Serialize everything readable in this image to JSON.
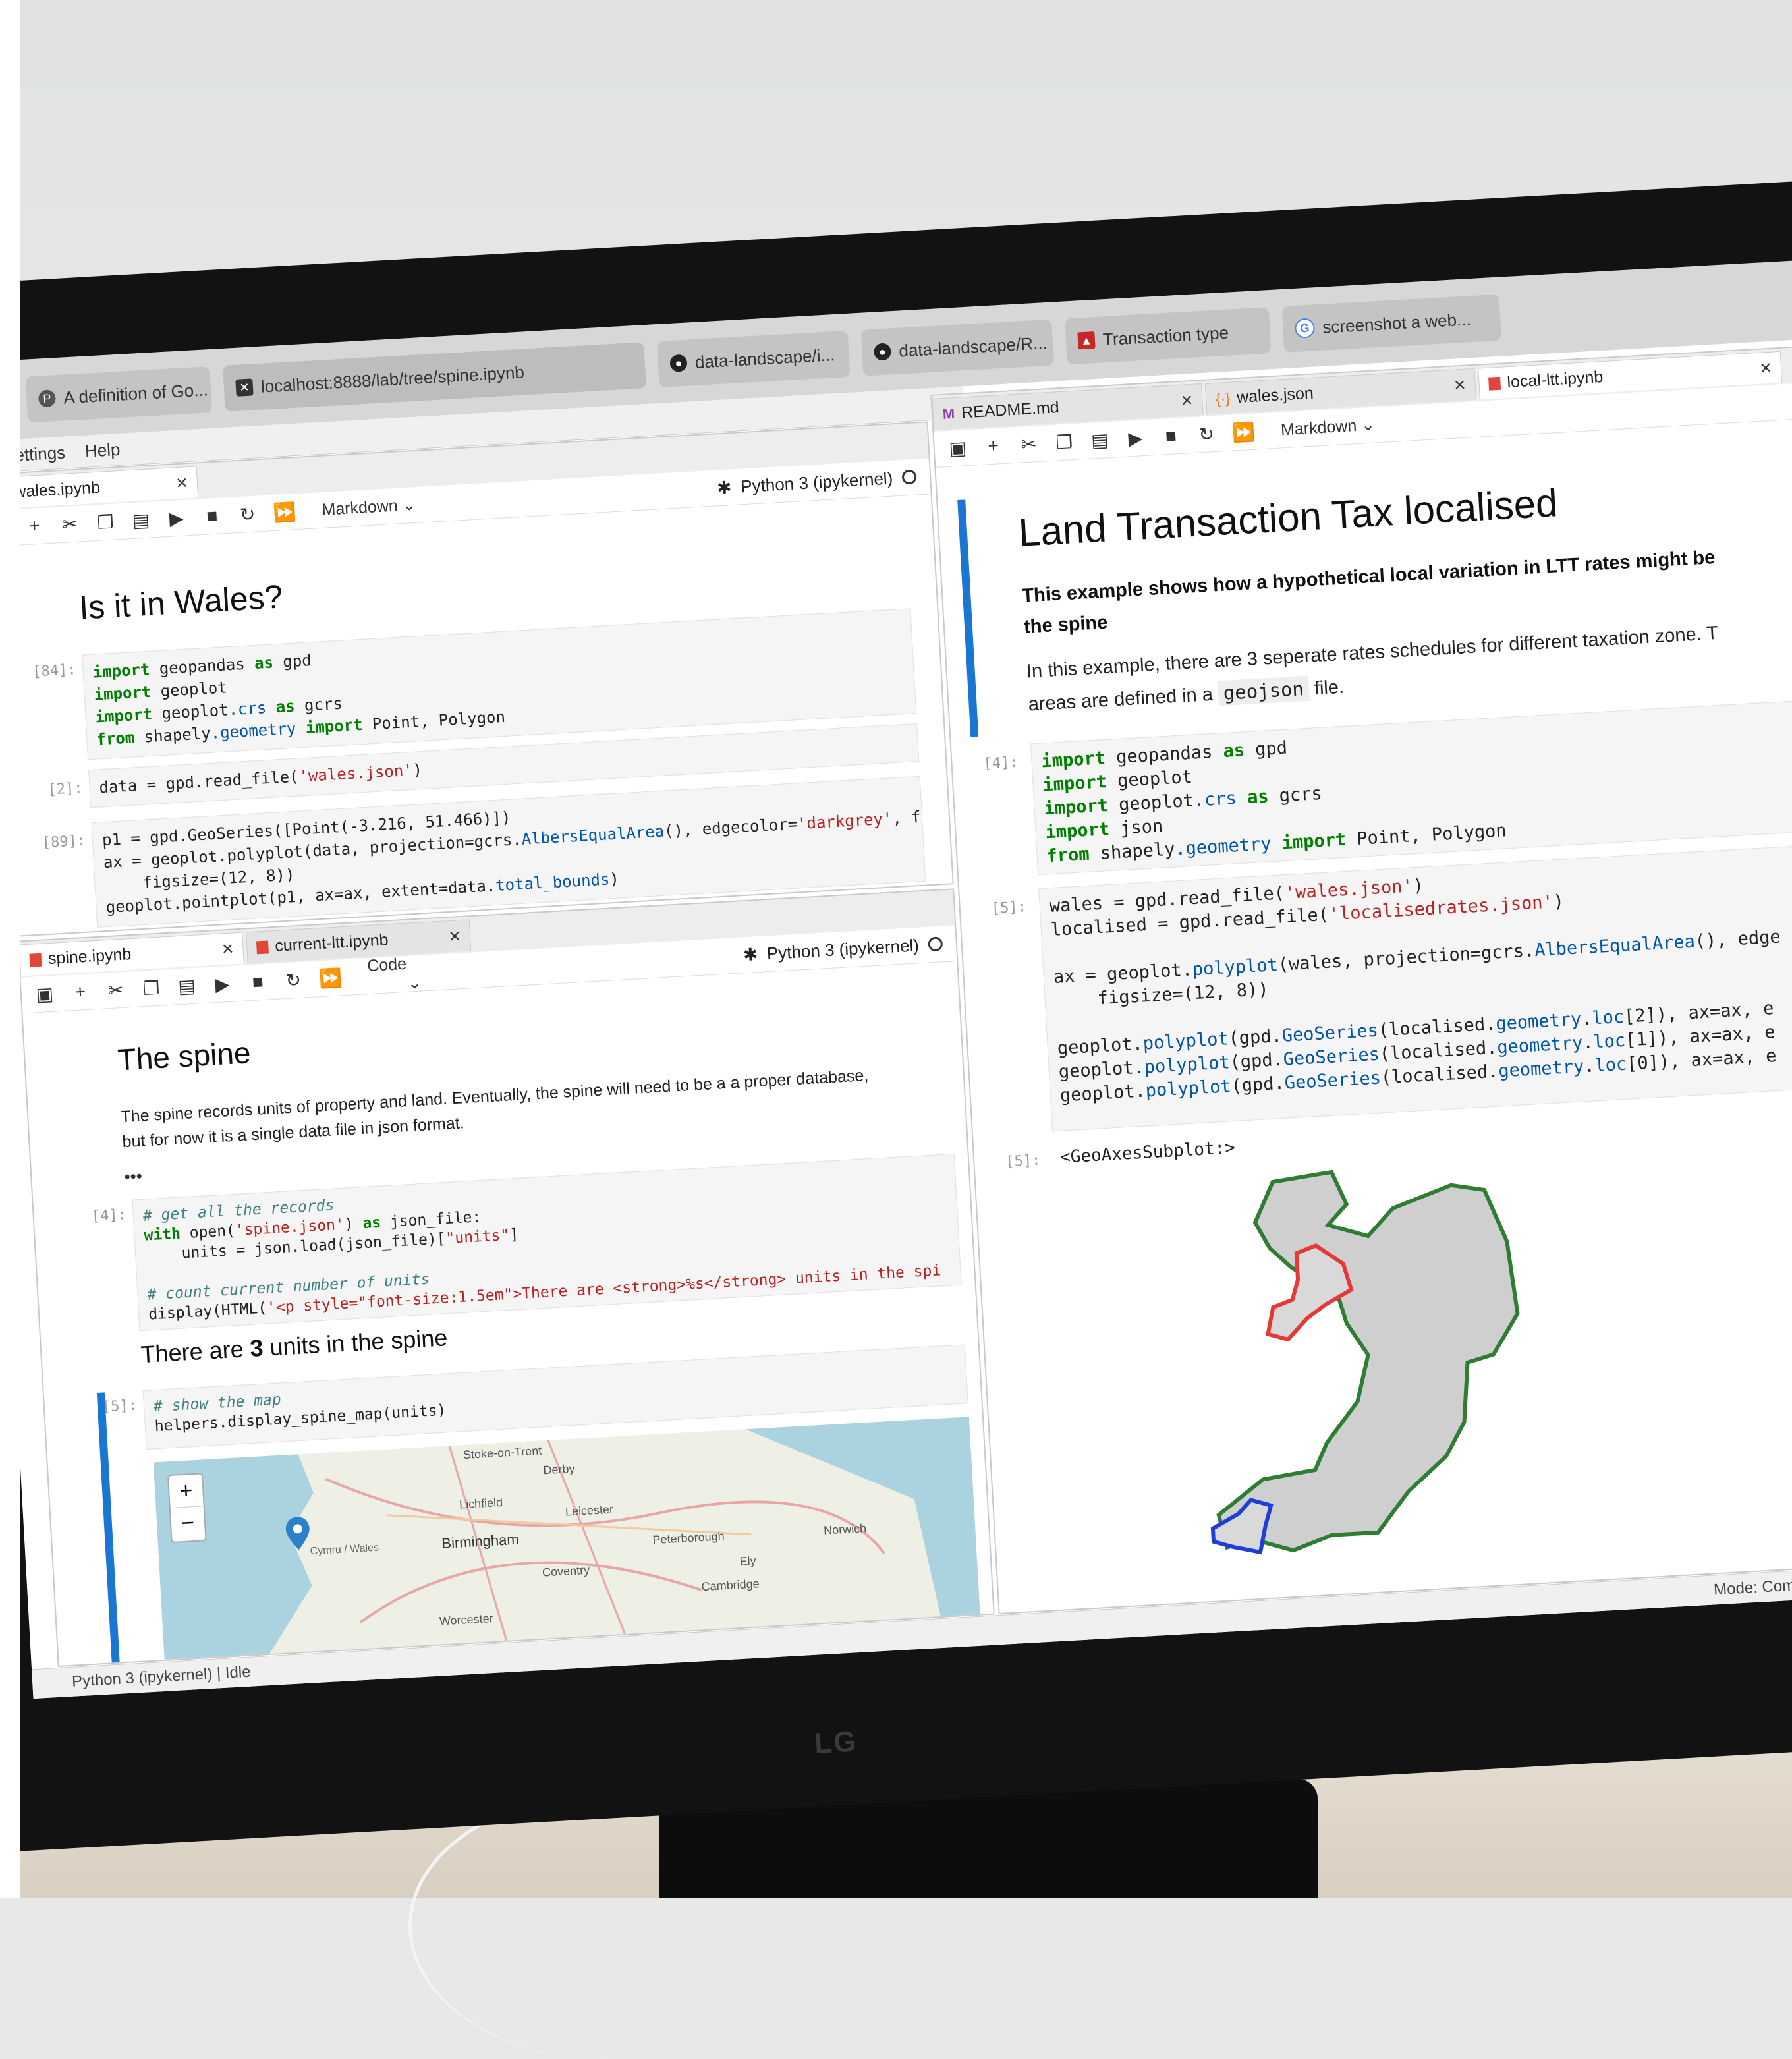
{
  "browser": {
    "tabs": [
      {
        "label": "A definition of Go...",
        "icon": "P"
      },
      {
        "label": "localhost:8888/lab/tree/spine.ipynb",
        "icon": "J"
      },
      {
        "label": "data-landscape/i...",
        "icon": "github"
      },
      {
        "label": "data-landscape/R...",
        "icon": "github"
      },
      {
        "label": "Transaction type",
        "icon": "wales-flag"
      },
      {
        "label": "screenshot a web...",
        "icon": "G"
      }
    ]
  },
  "menu": {
    "items": [
      "Settings",
      "Help"
    ]
  },
  "panel_top_left": {
    "tab": "iswales.ipynb",
    "cell_type": "Markdown",
    "kernel": "Python 3 (ipykernel)",
    "heading": "Is it in Wales?",
    "cells": [
      {
        "prompt": "[84]:",
        "lines": [
          "import geopandas as gpd",
          "import geoplot",
          "import geoplot.crs as gcrs",
          "from shapely.geometry import Point, Polygon"
        ]
      },
      {
        "prompt": "[2]:",
        "lines": [
          "data = gpd.read_file('wales.json')"
        ]
      },
      {
        "prompt": "[89]:",
        "lines": [
          "p1 = gpd.GeoSeries([Point(-3.216, 51.466)])",
          "ax = geoplot.polyplot(data, projection=gcrs.AlbersEqualArea(), edgecolor='darkgrey', fac",
          "    figsize=(12, 8))",
          "geoplot.pointplot(p1, ax=ax, extent=data.total_bounds)"
        ]
      }
    ]
  },
  "panel_bottom_left": {
    "tabs": [
      "spine.ipynb",
      "current-ltt.ipynb"
    ],
    "cell_type": "Code",
    "kernel": "Python 3 (ipykernel)",
    "heading": "The spine",
    "para1": "The spine records units of property and land. Eventually, the spine will need to be a a proper database,",
    "para2": "but for now it is a single data file in json format.",
    "ellipsis": "•••",
    "cell4": {
      "prompt": "[4]:",
      "lines": [
        "# get all the records",
        "with open('spine.json') as json_file:",
        "    units = json.load(json_file)[\"units\"]",
        "",
        "# count current number of units",
        "display(HTML('<p style=\"font-size:1.5em\">There are <strong>%s</strong> units in the spi"
      ]
    },
    "output_pre": "There are ",
    "output_num": "3",
    "output_post": " units in the spine",
    "cell5": {
      "prompt": "[5]:",
      "lines": [
        "# show the map",
        "helpers.display_spine_map(units)"
      ]
    },
    "map": {
      "zoom_in": "+",
      "zoom_out": "−",
      "places": [
        "Stoke-on-Trent",
        "Derby",
        "Lichfield",
        "Leicester",
        "Birmingham",
        "Peterborough",
        "Norwich",
        "Coventry",
        "Ely",
        "Cambridge",
        "Worcester",
        "Cymru / Wales"
      ]
    }
  },
  "panel_right": {
    "tabs": [
      "README.md",
      "wales.json",
      "local-ltt.ipynb"
    ],
    "cell_type": "Markdown",
    "heading": "Land Transaction Tax localised",
    "bold_line1": "This example shows how a hypothetical local variation in LTT rates might be",
    "bold_line2": "the spine",
    "para_line1": "In this example, there are 3 seperate rates schedules for different taxation zone. T",
    "para_line2_pre": "areas are defined in a ",
    "para_code": "geojson",
    "para_line2_post": " file.",
    "cell4": {
      "prompt": "[4]:",
      "lines": [
        "import geopandas as gpd",
        "import geoplot",
        "import geoplot.crs as gcrs",
        "import json",
        "from shapely.geometry import Point, Polygon"
      ]
    },
    "cell5": {
      "prompt": "[5]:",
      "lines": [
        "wales = gpd.read_file('wales.json')",
        "localised = gpd.read_file('localisedrates.json')",
        "",
        "ax = geoplot.polyplot(wales, projection=gcrs.AlbersEqualArea(), edge",
        "    figsize=(12, 8))",
        "",
        "geoplot.polyplot(gpd.GeoSeries(localised.geometry.loc[2]), ax=ax, e",
        "geoplot.polyplot(gpd.GeoSeries(localised.geometry.loc[1]), ax=ax, e",
        "geoplot.polyplot(gpd.GeoSeries(localised.geometry.loc[0]), ax=ax, e"
      ]
    },
    "out_prompt": "[5]:",
    "output": "<GeoAxesSubplot:>"
  },
  "status": {
    "left": "Python 3 (ipykernel) | Idle",
    "right": "Mode: Command"
  },
  "monitor": {
    "brand": "LG"
  },
  "colors": {
    "accent": "#1976d2",
    "wales_outline": "#2e7d32",
    "zone_red": "#e53935",
    "zone_blue": "#1e3ed6",
    "fill": "#cfcfcf"
  }
}
